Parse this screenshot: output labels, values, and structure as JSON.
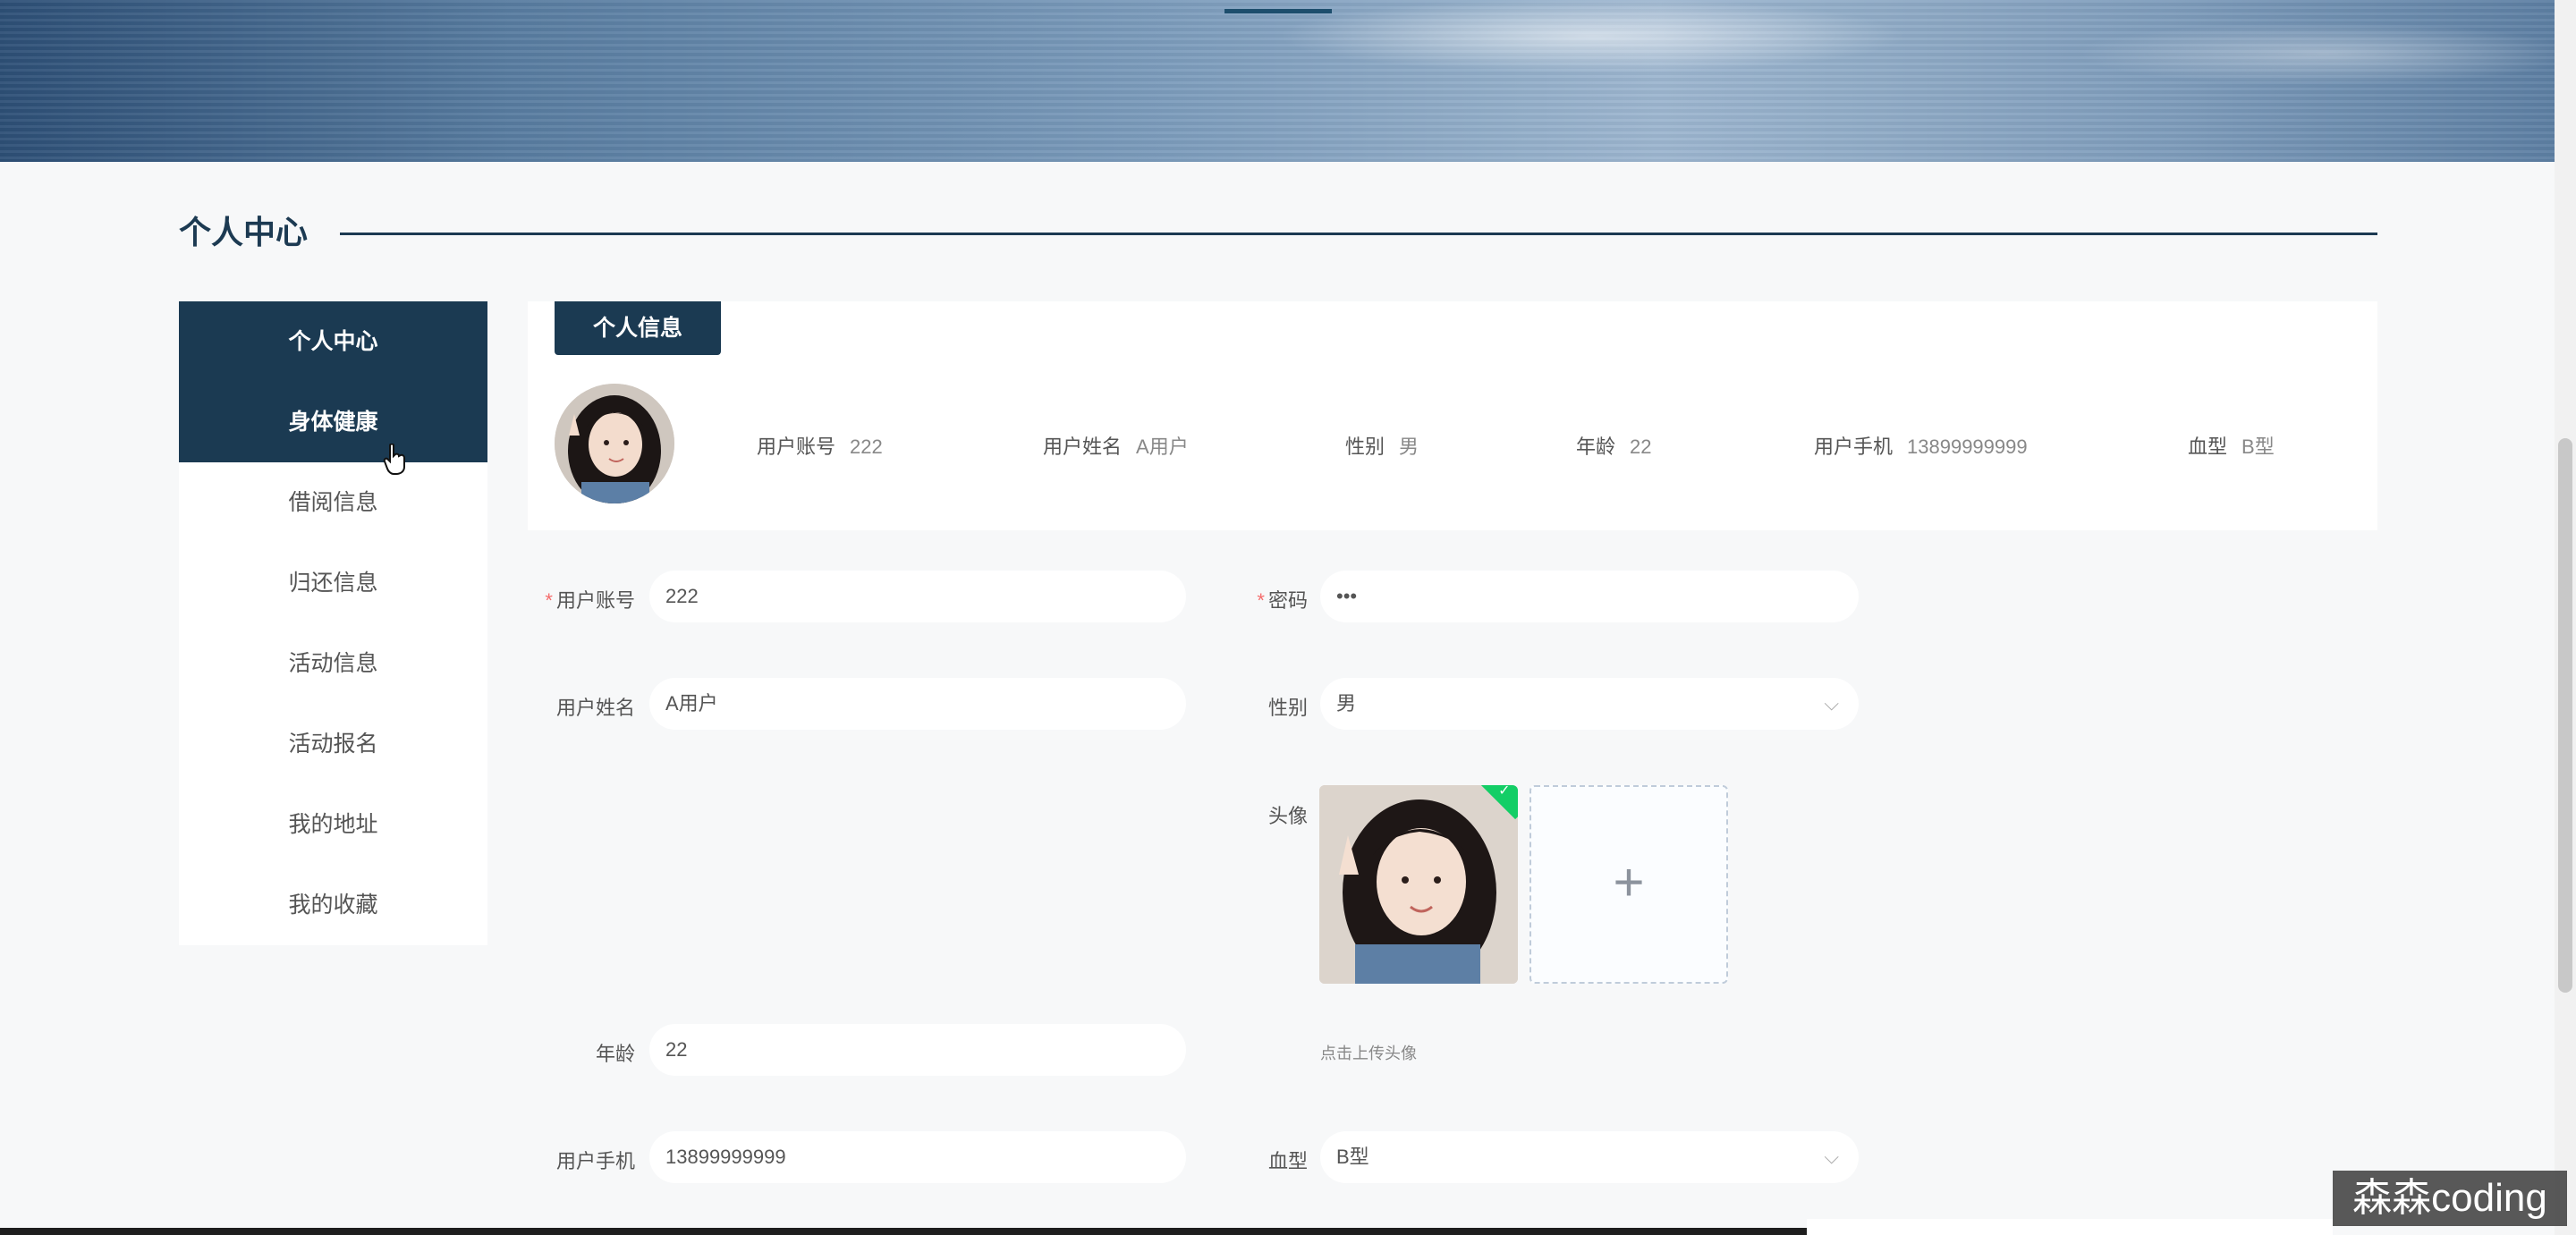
{
  "banner": {
    "active_indicator": "banner-slide-1"
  },
  "section": {
    "title": "个人中心"
  },
  "sidenav": {
    "items": [
      {
        "label": "个人中心",
        "active": true
      },
      {
        "label": "身体健康",
        "active": true
      },
      {
        "label": "借阅信息",
        "active": false
      },
      {
        "label": "归还信息",
        "active": false
      },
      {
        "label": "活动信息",
        "active": false
      },
      {
        "label": "活动报名",
        "active": false
      },
      {
        "label": "我的地址",
        "active": false
      },
      {
        "label": "我的收藏",
        "active": false
      }
    ]
  },
  "profile": {
    "tab_label": "个人信息",
    "summary": {
      "account_label": "用户账号",
      "account": "222",
      "name_label": "用户姓名",
      "name": "A用户",
      "gender_label": "性别",
      "gender": "男",
      "age_label": "年龄",
      "age": "22",
      "phone_label": "用户手机",
      "phone": "13899999999",
      "blood_label": "血型",
      "blood": "B型"
    }
  },
  "form": {
    "account_label": "用户账号",
    "account_value": "222",
    "password_label": "密码",
    "password_value": "•••",
    "name_label": "用户姓名",
    "name_value": "A用户",
    "gender_label": "性别",
    "gender_value": "男",
    "avatar_label": "头像",
    "upload_plus": "+",
    "upload_tip": "点击上传头像",
    "age_label": "年龄",
    "age_value": "22",
    "phone_label": "用户手机",
    "phone_value": "13899999999",
    "blood_label": "血型",
    "blood_value": "B型"
  },
  "watermark": {
    "text": "森森coding"
  },
  "colors": {
    "primary": "#1b3a52",
    "required": "#f56c6c",
    "success": "#13ce66"
  }
}
